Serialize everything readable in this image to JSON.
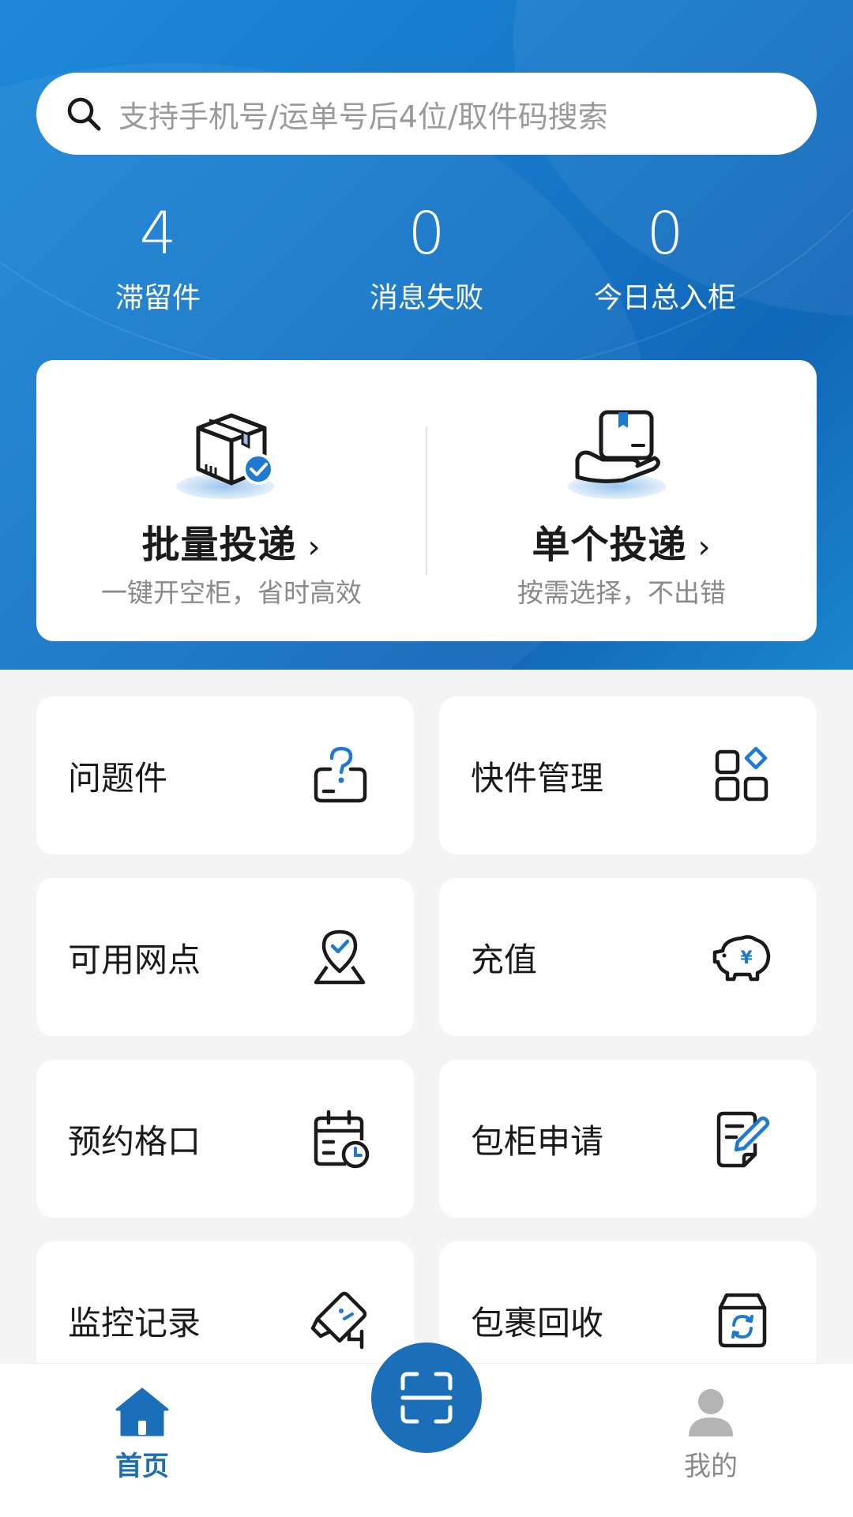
{
  "colors": {
    "primary": "#1a6fb8",
    "hero_bg": "#1677c8",
    "accent_icon": "#1e7ad0",
    "inactive": "#8a8a8a"
  },
  "search": {
    "placeholder": "支持手机号/运单号后4位/取件码搜索",
    "icon": "search-icon"
  },
  "stats": [
    {
      "value": "4",
      "label": "滞留件"
    },
    {
      "value": "0",
      "label": "消息失败"
    },
    {
      "value": "0",
      "label": "今日总入柜"
    }
  ],
  "delivery": {
    "batch": {
      "title": "批量投递",
      "subtitle": "一键开空柜，省时高效",
      "icon": "package-check-icon"
    },
    "single": {
      "title": "单个投递",
      "subtitle": "按需选择，不出错",
      "icon": "hand-package-icon"
    },
    "chevron": "›"
  },
  "grid": [
    {
      "label": "问题件",
      "icon": "question-box-icon"
    },
    {
      "label": "快件管理",
      "icon": "apps-grid-icon"
    },
    {
      "label": "可用网点",
      "icon": "location-check-icon"
    },
    {
      "label": "充值",
      "icon": "piggy-bank-icon"
    },
    {
      "label": "预约格口",
      "icon": "calendar-clock-icon"
    },
    {
      "label": "包柜申请",
      "icon": "document-edit-icon"
    },
    {
      "label": "监控记录",
      "icon": "camera-icon"
    },
    {
      "label": "包裹回收",
      "icon": "box-recycle-icon"
    }
  ],
  "tabbar": {
    "home": {
      "label": "首页",
      "icon": "home-icon",
      "active": true
    },
    "scan": {
      "icon": "scan-icon"
    },
    "mine": {
      "label": "我的",
      "icon": "user-icon",
      "active": false
    }
  }
}
